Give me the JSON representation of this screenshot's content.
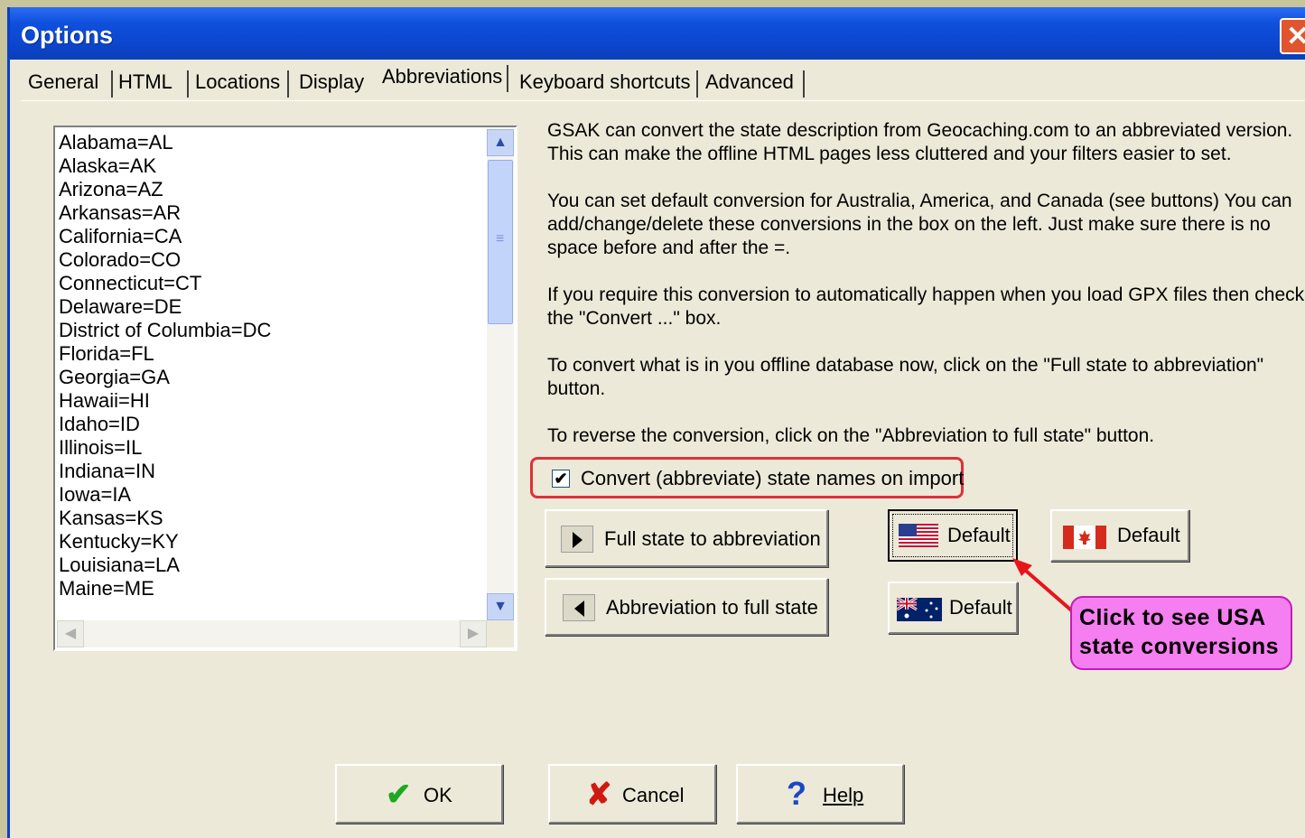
{
  "window": {
    "title": "Options",
    "close_glyph": "✕"
  },
  "tabs": [
    "General",
    "HTML",
    "Locations",
    "Display",
    "Abbreviations",
    "Keyboard shortcuts",
    "Advanced"
  ],
  "active_tab": "Abbreviations",
  "abbreviations": [
    "Alabama=AL",
    "Alaska=AK",
    "Arizona=AZ",
    "Arkansas=AR",
    "California=CA",
    "Colorado=CO",
    "Connecticut=CT",
    "Delaware=DE",
    "District of Columbia=DC",
    "Florida=FL",
    "Georgia=GA",
    "Hawaii=HI",
    "Idaho=ID",
    "Illinois=IL",
    "Indiana=IN",
    "Iowa=IA",
    "Kansas=KS",
    "Kentucky=KY",
    "Louisiana=LA",
    "Maine=ME"
  ],
  "description": [
    "GSAK can convert the state description from Geocaching.com to an abbreviated version.",
    "This can make the offline HTML pages less cluttered and your filters easier to set.",
    "You can set default conversion for Australia, America, and Canada  (see buttons) You can",
    "add/change/delete these conversions in the box on the left. Just make sure there is no",
    "space before and after the =.",
    "If you require this conversion to automatically happen when you load GPX files then check",
    "the \"Convert ...\" box.",
    "To convert what is in you offline database now, click on the \"Full state to abbreviation\"",
    "button.",
    "To reverse the conversion, click on the \"Abbreviation to full state\" button."
  ],
  "convert_checkbox": {
    "label": "Convert (abbreviate) state names on import",
    "checked": true,
    "mark": "✔"
  },
  "buttons": {
    "full_to_abbrev": "Full state to abbreviation",
    "abbrev_to_full": "Abbreviation to full state",
    "default_usa": "Default",
    "default_canada": "Default",
    "default_australia": "Default",
    "ok": "OK",
    "cancel": "Cancel",
    "help": "Help"
  },
  "callout": {
    "line1": "Click to see USA",
    "line2": "state conversions"
  },
  "icons": {
    "scroll_up": "▲",
    "scroll_down": "▼",
    "scroll_left": "◀",
    "scroll_right": "▶",
    "grip": "≡",
    "ok": "✔",
    "cancel": "✘",
    "help": "?"
  },
  "colors": {
    "title_bar": "#0b46cf",
    "highlight_border": "#e0303a",
    "callout_fill": "#f57ef0",
    "arrow": "#e8141c",
    "ok_check": "#1ea820",
    "cancel_x": "#d01a10",
    "help_q": "#1848c8"
  }
}
